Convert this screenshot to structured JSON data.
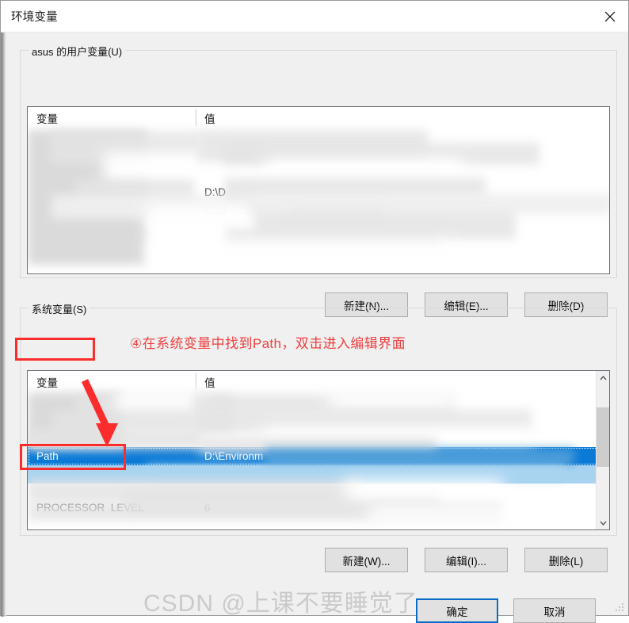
{
  "window": {
    "title": "环境变量",
    "close_icon": "close-icon"
  },
  "user_section": {
    "legend": "asus 的用户变量(U)",
    "columns": {
      "variable": "变量",
      "value": "值"
    },
    "rows": [
      {
        "variable": "",
        "value": ""
      },
      {
        "variable": "",
        "value": ""
      },
      {
        "variable": "",
        "value": ""
      },
      {
        "variable": "",
        "value": "D:\\D"
      },
      {
        "variable": "",
        "value": "C:\\U"
      },
      {
        "variable": "",
        "value": ""
      }
    ],
    "buttons": {
      "new": "新建(N)...",
      "edit": "编辑(E)...",
      "delete": "删除(D)"
    }
  },
  "system_section": {
    "legend": "系统变量(S)",
    "columns": {
      "variable": "变量",
      "value": "值"
    },
    "rows": [
      {
        "variable": "",
        "value": ""
      },
      {
        "variable": "",
        "value": ""
      },
      {
        "variable": "",
        "value": ""
      },
      {
        "variable": "Path",
        "value": "D:\\Environm",
        "selected": true
      },
      {
        "variable": "",
        "value": ""
      },
      {
        "variable": "",
        "value": ""
      },
      {
        "variable": "PROCESSOR_LEVEL",
        "value": "6"
      }
    ],
    "buttons": {
      "new": "新建(W)...",
      "edit": "编辑(I)...",
      "delete": "删除(L)"
    },
    "scrollbar": {
      "up_icon": "chevron-up-icon",
      "down_icon": "chevron-down-icon"
    }
  },
  "footer": {
    "ok": "确定",
    "cancel": "取消"
  },
  "annotations": {
    "step_text": "④在系统变量中找到Path，双击进入编辑界面",
    "box_system_label": "系统变量(S)",
    "box_path_label": "Path",
    "arrow": "red-arrow-icon",
    "color": "#fb2c2c"
  },
  "watermark": {
    "text": "CSDN @上课不要睡觉了"
  },
  "colors": {
    "accent_selection": "#0a7ad6",
    "annotation_red": "#fb2c2c",
    "dialog_bg": "#f0f0f0",
    "focus_blue": "#0a6cc4"
  }
}
